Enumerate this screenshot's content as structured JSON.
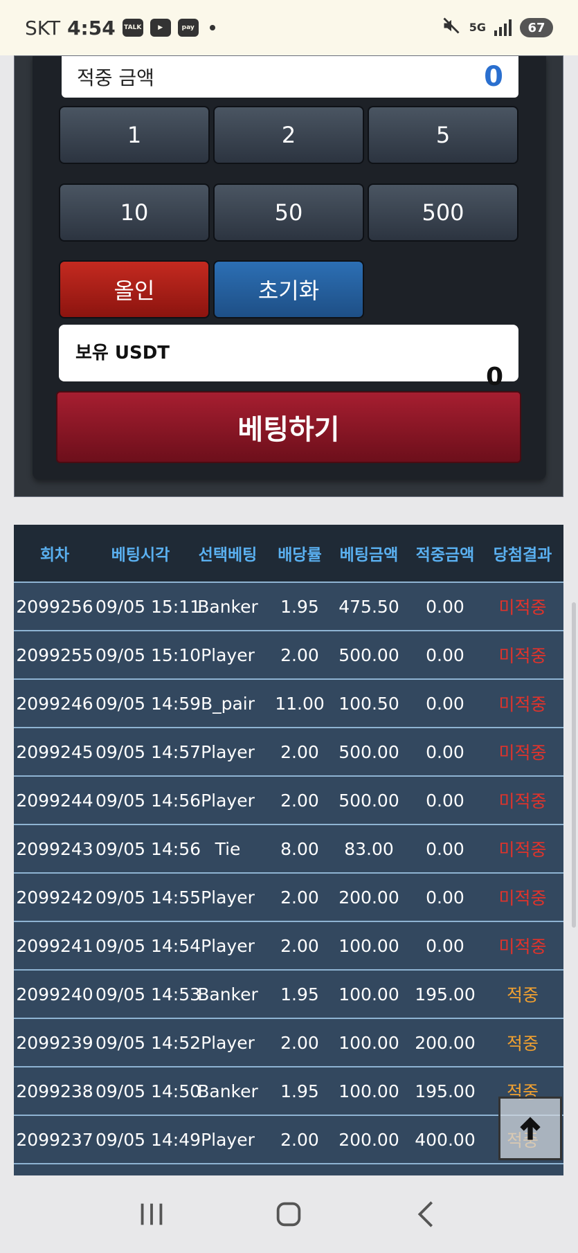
{
  "status_bar": {
    "carrier": "SKT",
    "time": "4:54",
    "app_icons": [
      "talk-icon",
      "youtube-icon",
      "pay-icon"
    ],
    "network": "5G",
    "battery": "67"
  },
  "panel": {
    "win_amount_label": "적중 금액",
    "win_amount_value": "0",
    "chips": [
      "1",
      "2",
      "5",
      "10",
      "50",
      "500"
    ],
    "allin_label": "올인",
    "reset_label": "초기화",
    "usdt_label": "보유 USDT",
    "usdt_value": "0",
    "bet_button_label": "베팅하기"
  },
  "table": {
    "headers": [
      "회차",
      "베팅시각",
      "선택베팅",
      "배당률",
      "베팅금액",
      "적중금액",
      "당첨결과"
    ],
    "rows": [
      [
        "2099256",
        "09/05 15:11",
        "Banker",
        "1.95",
        "475.50",
        "0.00",
        "미적중"
      ],
      [
        "2099255",
        "09/05 15:10",
        "Player",
        "2.00",
        "500.00",
        "0.00",
        "미적중"
      ],
      [
        "2099246",
        "09/05 14:59",
        "B_pair",
        "11.00",
        "100.50",
        "0.00",
        "미적중"
      ],
      [
        "2099245",
        "09/05 14:57",
        "Player",
        "2.00",
        "500.00",
        "0.00",
        "미적중"
      ],
      [
        "2099244",
        "09/05 14:56",
        "Player",
        "2.00",
        "500.00",
        "0.00",
        "미적중"
      ],
      [
        "2099243",
        "09/05 14:56",
        "Tie",
        "8.00",
        "83.00",
        "0.00",
        "미적중"
      ],
      [
        "2099242",
        "09/05 14:55",
        "Player",
        "2.00",
        "200.00",
        "0.00",
        "미적중"
      ],
      [
        "2099241",
        "09/05 14:54",
        "Player",
        "2.00",
        "100.00",
        "0.00",
        "미적중"
      ],
      [
        "2099240",
        "09/05 14:53",
        "Banker",
        "1.95",
        "100.00",
        "195.00",
        "적중"
      ],
      [
        "2099239",
        "09/05 14:52",
        "Player",
        "2.00",
        "100.00",
        "200.00",
        "적중"
      ],
      [
        "2099238",
        "09/05 14:50",
        "Banker",
        "1.95",
        "100.00",
        "195.00",
        "적중"
      ],
      [
        "2099237",
        "09/05 14:49",
        "Player",
        "2.00",
        "200.00",
        "400.00",
        "적중"
      ]
    ]
  },
  "colors": {
    "miss": "#e0332b",
    "hit": "#f0a030",
    "header_text": "#5ab0f0",
    "win_value": "#2a6fcf"
  }
}
